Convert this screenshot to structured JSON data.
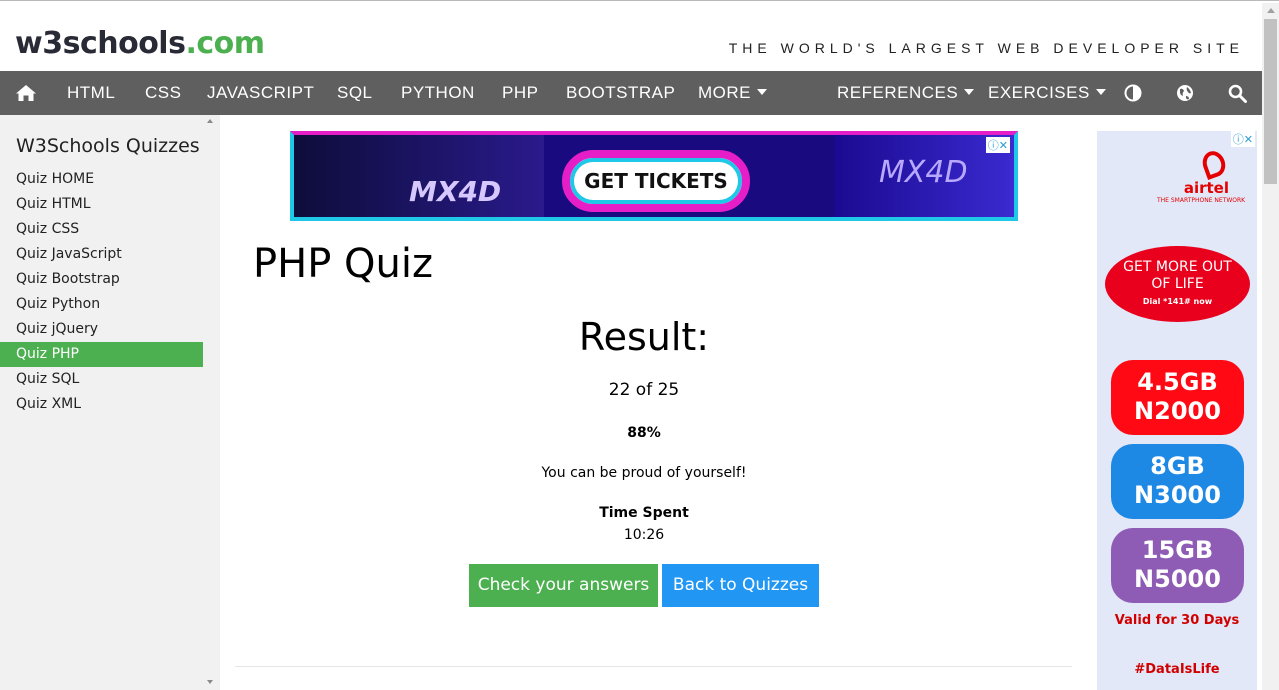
{
  "header": {
    "logo_main": "w3schools",
    "logo_suffix": ".com",
    "tagline": "THE WORLD'S LARGEST WEB DEVELOPER SITE"
  },
  "nav": {
    "items": [
      "HTML",
      "CSS",
      "JAVASCRIPT",
      "SQL",
      "PYTHON",
      "PHP",
      "BOOTSTRAP",
      "MORE"
    ],
    "right_items": [
      "REFERENCES",
      "EXERCISES"
    ],
    "icons": [
      "home-icon",
      "contrast-icon",
      "globe-icon",
      "search-icon"
    ]
  },
  "sidebar": {
    "title": "W3Schools Quizzes",
    "items": [
      "Quiz HOME",
      "Quiz HTML",
      "Quiz CSS",
      "Quiz JavaScript",
      "Quiz Bootstrap",
      "Quiz Python",
      "Quiz jQuery",
      "Quiz PHP",
      "Quiz SQL",
      "Quiz XML"
    ],
    "active_item": "Quiz PHP"
  },
  "ad_top": {
    "cta": "GET TICKETS",
    "brand": "MX4D",
    "close": "ⓘ✕"
  },
  "main": {
    "title": "PHP Quiz",
    "result_heading": "Result:",
    "score": "22 of 25",
    "percent": "88%",
    "message": "You can be proud of yourself!",
    "time_label": "Time Spent",
    "time_value": "10:26",
    "check_button": "Check your answers",
    "back_button": "Back to Quizzes"
  },
  "ad_side": {
    "close": "ⓘ✕",
    "brand": "airtel",
    "tagline": "THE SMARTPHONE NETWORK",
    "promo_line1": "GET MORE OUT",
    "promo_line2": "OF LIFE",
    "promo_line3": "Dial *141# now",
    "pills": [
      {
        "line1": "4.5GB",
        "line2": "N2000",
        "color": "#ff0a14"
      },
      {
        "line1": "8GB",
        "line2": "N3000",
        "color": "#1e88e5"
      },
      {
        "line1": "15GB",
        "line2": "N5000",
        "color": "#8e5cb5"
      }
    ],
    "valid": "Valid for 30 Days",
    "hashtag": "#DataIsLife"
  },
  "colors": {
    "accent_green": "#4CAF50",
    "accent_blue": "#2196F3",
    "nav_bg": "#5f5f5f"
  }
}
